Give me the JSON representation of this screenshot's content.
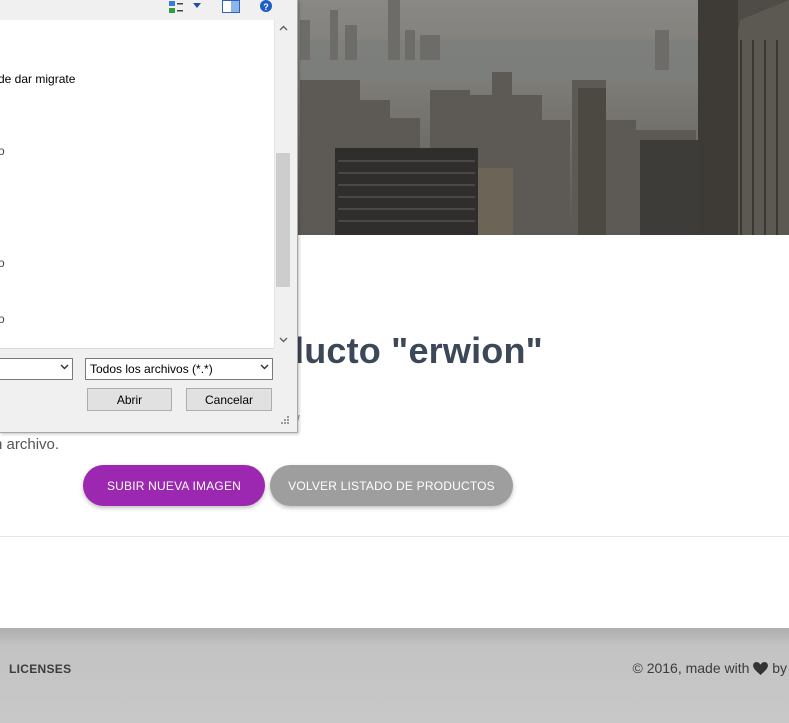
{
  "dialog": {
    "files": [
      {
        "label": "de dar migrate"
      },
      {
        "label": "o"
      },
      {
        "label": "o"
      },
      {
        "label": "o"
      }
    ],
    "file_type_value": "Todos los archivos (*.*)",
    "filename_value": "",
    "open_label": "Abrir",
    "cancel_label": "Cancelar",
    "icons": [
      "view-options-icon",
      "dropdown-arrow-icon",
      "preview-pane-icon",
      "help-icon"
    ]
  },
  "page": {
    "title_visible": "ducto \"erwion\"",
    "desc_line1": "w",
    "desc_line2": "n archivo.",
    "upload_button": "SUBIR NUEVA IMAGEN",
    "back_button": "VOLVER LISTADO DE PRODUCTOS"
  },
  "footer": {
    "licenses_label": "LICENSES",
    "copyright_prefix": "© 2016, made with",
    "copyright_suffix": "by"
  },
  "colors": {
    "primary": "#9c27b0",
    "secondary": "#9e9e9e",
    "title": "#3c4858"
  }
}
